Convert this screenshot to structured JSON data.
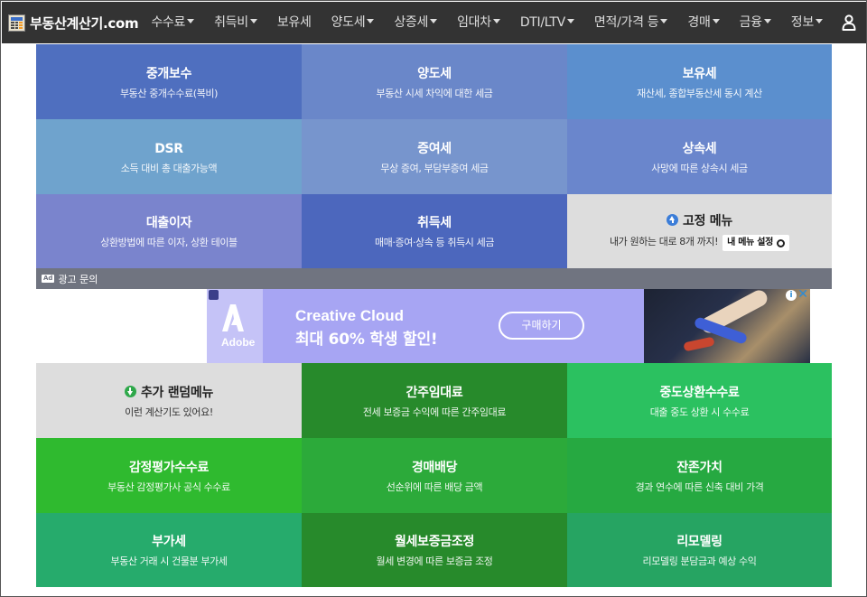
{
  "brand": {
    "name": "부동산계산기.com"
  },
  "nav": {
    "items": [
      {
        "label": "수수료",
        "dropdown": true
      },
      {
        "label": "취득비",
        "dropdown": true
      },
      {
        "label": "보유세",
        "dropdown": false
      },
      {
        "label": "양도세",
        "dropdown": true
      },
      {
        "label": "상증세",
        "dropdown": true
      },
      {
        "label": "임대차",
        "dropdown": true
      },
      {
        "label": "DTI/LTV",
        "dropdown": true
      },
      {
        "label": "면적/가격 등",
        "dropdown": true
      },
      {
        "label": "경매",
        "dropdown": true
      },
      {
        "label": "금융",
        "dropdown": true
      },
      {
        "label": "정보",
        "dropdown": true
      }
    ],
    "user_icon": "user-icon"
  },
  "top_tiles": [
    {
      "title": "중개보수",
      "sub": "부동산 중개수수료(복비)",
      "color": "#4f6fbf"
    },
    {
      "title": "양도세",
      "sub": "부동산 시세 차익에 대한 세금",
      "color": "#6a87c9"
    },
    {
      "title": "보유세",
      "sub": "재산세, 종합부동산세 동시 계산",
      "color": "#5b8fce"
    },
    {
      "title": "DSR",
      "sub": "소득 대비 총 대출가능액",
      "color": "#6fa3cd"
    },
    {
      "title": "증여세",
      "sub": "무상 증여, 부담부증여 세금",
      "color": "#7795cd"
    },
    {
      "title": "상속세",
      "sub": "사망에 따른 상속시 세금",
      "color": "#6a86cc"
    },
    {
      "title": "대출이자",
      "sub": "상환방법에 따른 이자, 상환 테이블",
      "color": "#7a84cd"
    },
    {
      "title": "취득세",
      "sub": "매매·증여·상속 등 취득시 세금",
      "color": "#4c67bd"
    }
  ],
  "fixed_menu": {
    "title": "고정 메뉴",
    "sub": "내가 원하는 대로 8개 까지!",
    "button": "내 메뉴 설정",
    "color": "#dddddd"
  },
  "ad": {
    "label": "광고 문의",
    "badge": "Ad",
    "brand": "Adobe",
    "headline": "Creative Cloud",
    "subline": "최대 60% 학생 할인!",
    "cta": "구매하기",
    "info": "i",
    "close": "✕"
  },
  "random_menu": {
    "title": "추가 랜덤메뉴",
    "sub": "이런 계산기도 있어요!",
    "color": "#dddddd"
  },
  "bottom_tiles": [
    {
      "title": "간주임대료",
      "sub": "전세 보증금 수익에 따른 간주임대료",
      "color": "#278a2b"
    },
    {
      "title": "중도상환수수료",
      "sub": "대출 중도 상환 시 수수료",
      "color": "#2bc160"
    },
    {
      "title": "감정평가수수료",
      "sub": "부동산 감정평가사 공식 수수료",
      "color": "#2fba2f"
    },
    {
      "title": "경매배당",
      "sub": "선순위에 따른 배당 금액",
      "color": "#2caa3a"
    },
    {
      "title": "잔존가치",
      "sub": "경과 연수에 따른 신축 대비 가격",
      "color": "#26a941"
    },
    {
      "title": "부가세",
      "sub": "부동산 거래 시 건물분 부가세",
      "color": "#26ab6c"
    },
    {
      "title": "월세보증금조정",
      "sub": "월세 변경에 따른 보증금 조정",
      "color": "#278a2b"
    },
    {
      "title": "리모델링",
      "sub": "리모델링 분담금과 예상 수익",
      "color": "#26a462"
    }
  ]
}
